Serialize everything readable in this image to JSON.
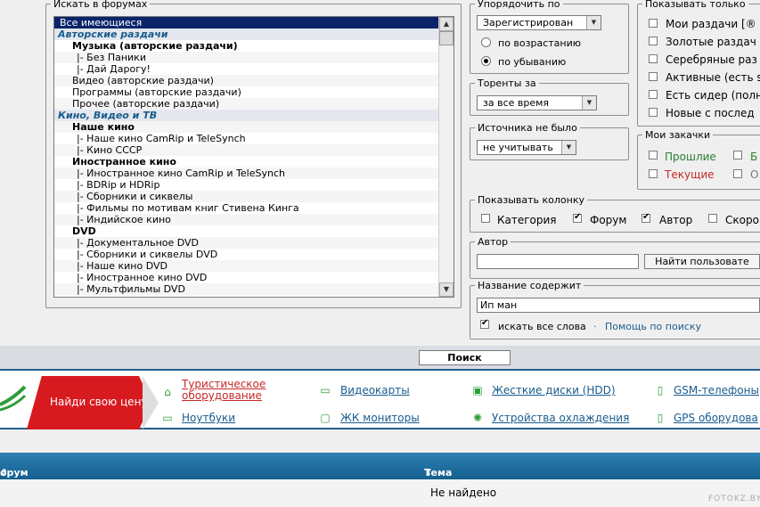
{
  "forums": {
    "legend": "Искать в форумах",
    "items": [
      {
        "label": "Все имеющиеся",
        "kind": "sel"
      },
      {
        "label": "Авторские раздачи",
        "kind": "cat"
      },
      {
        "label": "Музыка (авторские раздачи)",
        "kind": "sub"
      },
      {
        "label": "|- Без Паники",
        "kind": "lvl"
      },
      {
        "label": "|- Дай Дарогу!",
        "kind": "lvl"
      },
      {
        "label": "Видео (авторские раздачи)",
        "kind": "item"
      },
      {
        "label": "Программы (авторские раздачи)",
        "kind": "item"
      },
      {
        "label": "Прочее (авторские раздачи)",
        "kind": "item"
      },
      {
        "label": "Кино, Видео и ТВ",
        "kind": "cat"
      },
      {
        "label": "Наше кино",
        "kind": "sub"
      },
      {
        "label": "|- Наше кино CamRip и TeleSynch",
        "kind": "lvl"
      },
      {
        "label": "|- Кино СССР",
        "kind": "lvl"
      },
      {
        "label": "Иностранное кино",
        "kind": "sub"
      },
      {
        "label": "|- Иностранное кино CamRip и TeleSynch",
        "kind": "lvl"
      },
      {
        "label": "|- BDRip и HDRip",
        "kind": "lvl"
      },
      {
        "label": "|- Сборники и сиквелы",
        "kind": "lvl"
      },
      {
        "label": "|- Фильмы по мотивам книг Стивена Кинга",
        "kind": "lvl"
      },
      {
        "label": "|- Индийское кино",
        "kind": "lvl"
      },
      {
        "label": "DVD",
        "kind": "sub"
      },
      {
        "label": "|- Документальное DVD",
        "kind": "lvl"
      },
      {
        "label": "|- Сборники и сиквелы DVD",
        "kind": "lvl"
      },
      {
        "label": "|- Наше кино DVD",
        "kind": "lvl"
      },
      {
        "label": "|- Иностранное кино DVD",
        "kind": "lvl"
      },
      {
        "label": "|- Мультфильмы DVD",
        "kind": "lvl"
      }
    ]
  },
  "sort": {
    "legend": "Упорядочить по",
    "selected": "Зарегистрирован",
    "asc_label": "по возрастанию",
    "desc_label": "по убыванию"
  },
  "torrents": {
    "legend": "Торенты за",
    "selected": "за все время"
  },
  "source": {
    "legend": "Источника не было",
    "selected": "не учитывать"
  },
  "show_only": {
    "legend": "Показывать только",
    "items": [
      "Мои раздачи [®",
      "Золотые раздач",
      "Серебряные раз",
      "Активные (есть s",
      "Есть сидер (полн",
      "Новые с послед"
    ]
  },
  "my_downloads": {
    "legend": "Мои закачки",
    "past": "Прошлие",
    "current": "Текущие",
    "b": "Б",
    "o": "О",
    "past_color": "#2e7d32",
    "current_color": "#c62828"
  },
  "columns": {
    "legend": "Показывать колонку",
    "category": "Категория",
    "forum": "Форум",
    "author": "Автор",
    "skoro": "Скоро"
  },
  "author": {
    "legend": "Автор",
    "value": "",
    "find_button": "Найти пользовате"
  },
  "title_search": {
    "legend": "Название содержит",
    "value": "Ип ман",
    "all_words": "искать все слова",
    "sep": "·",
    "help": "Помощь по поиску"
  },
  "search_button": "Поиск",
  "ad": {
    "cta": "Найди свою цену",
    "items": [
      {
        "label": "Туристическое оборудование",
        "icon": "house-icon"
      },
      {
        "label": "Видеокарты",
        "icon": "video-card-icon"
      },
      {
        "label": "Жесткие диски (HDD)",
        "icon": "hdd-icon"
      },
      {
        "label": "GSM-телефоны",
        "icon": "phone-icon"
      },
      {
        "label": "Ноутбуки",
        "icon": "laptop-icon"
      },
      {
        "label": "ЖК мониторы",
        "icon": "monitor-icon"
      },
      {
        "label": "Устройства охлаждения",
        "icon": "cooler-icon"
      },
      {
        "label": "GPS оборудова",
        "icon": "gps-icon"
      }
    ],
    "line1": "Туристическое",
    "line2": "оборудование",
    "red": "#d71920"
  },
  "table": {
    "col_forum": "орум",
    "col_topic": "Тема",
    "empty": "Не найдено"
  },
  "watermark": "FOTOKZ.BY"
}
